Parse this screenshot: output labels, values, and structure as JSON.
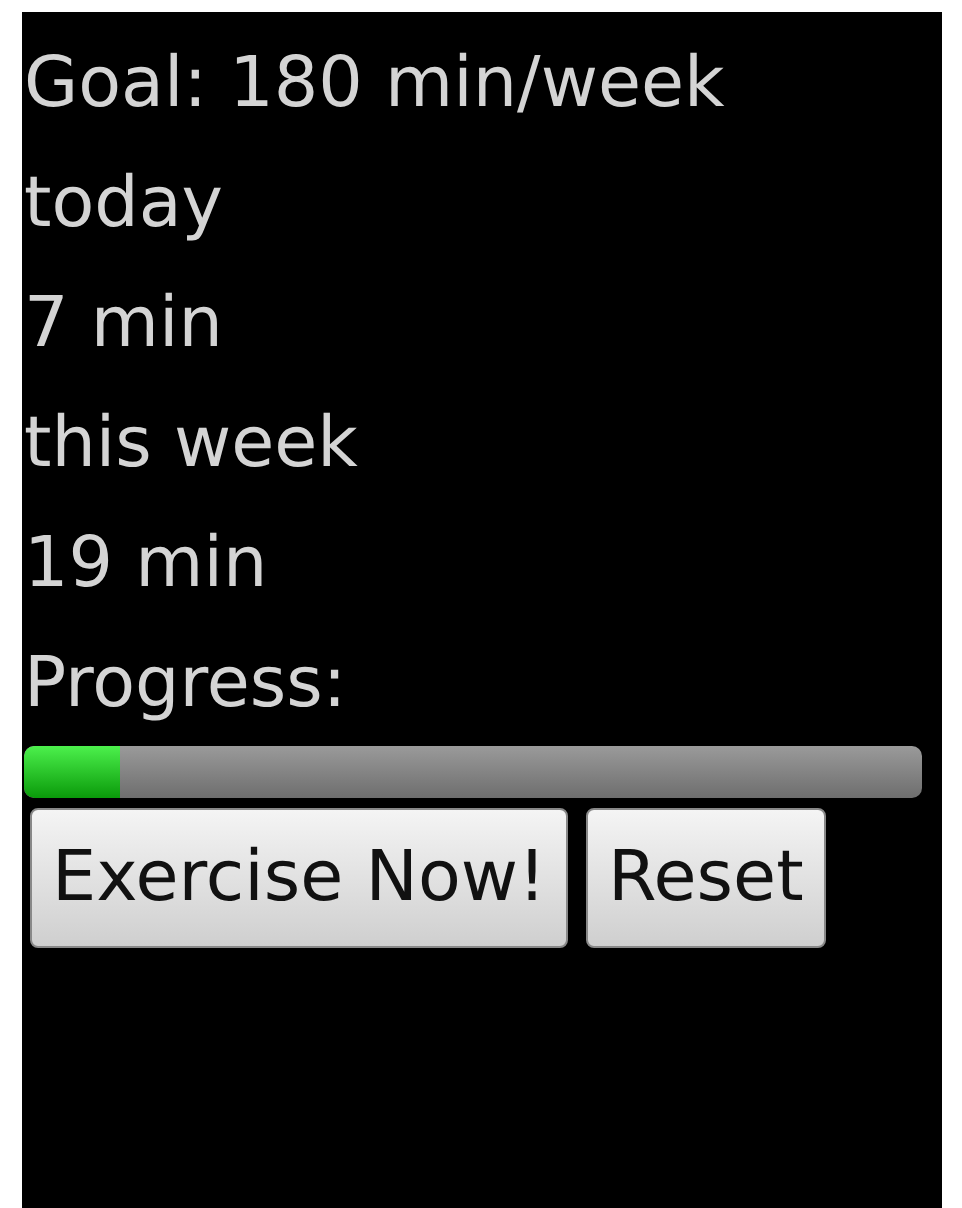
{
  "lines": [
    "Goal: 180 min/week",
    "today",
    "7 min",
    "this week",
    "19 min",
    "Progress:"
  ],
  "progress": {
    "level": 0.106
  },
  "buttons": [
    "Exercise Now!",
    "Reset"
  ]
}
